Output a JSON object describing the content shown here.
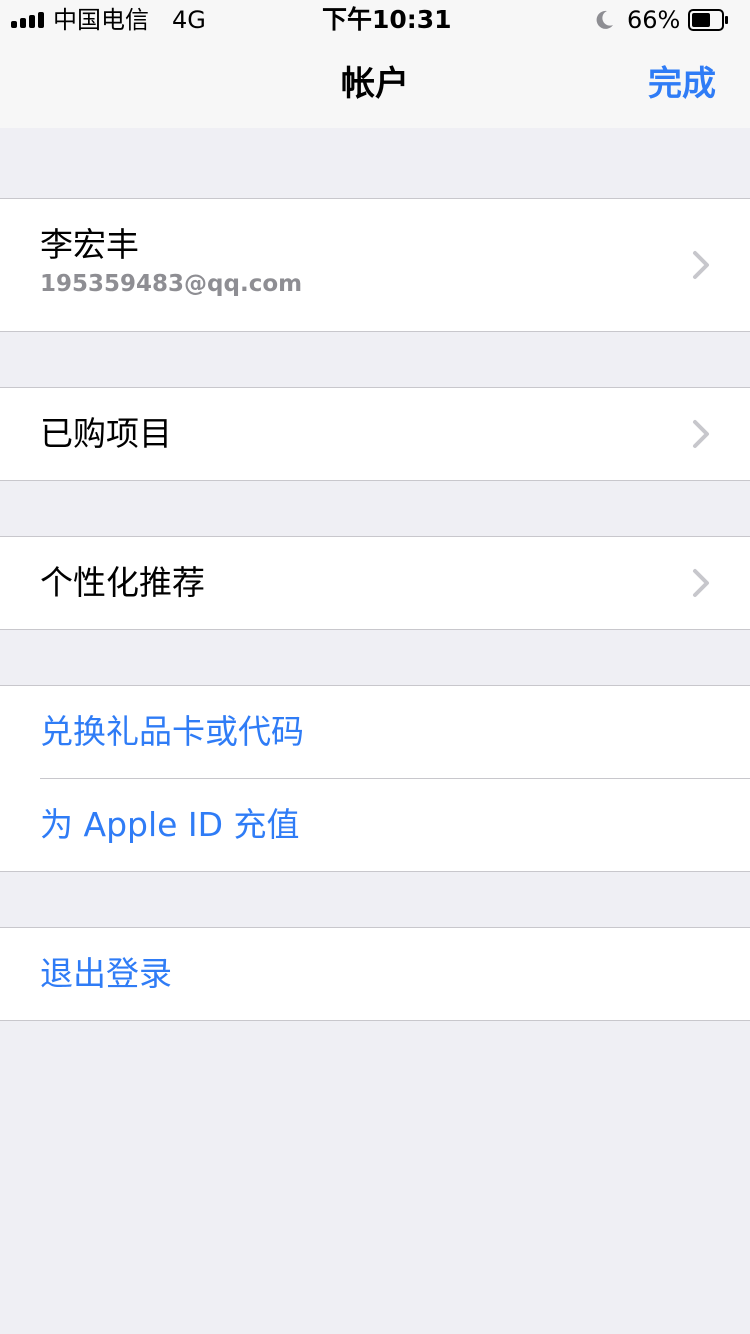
{
  "status_bar": {
    "carrier": "中国电信",
    "network": "4G",
    "time": "下午10:31",
    "battery_percent": "66%",
    "battery_level": 0.66,
    "icons": [
      "signal-icon",
      "moon-icon",
      "battery-icon"
    ]
  },
  "nav": {
    "title": "帐户",
    "done_label": "完成"
  },
  "account": {
    "name": "李宏丰",
    "email": "195359483@qq.com"
  },
  "rows": {
    "purchased": "已购项目",
    "personalized": "个性化推荐",
    "redeem": "兑换礼品卡或代码",
    "add_funds": "为 Apple ID 充值",
    "sign_out": "退出登录"
  },
  "colors": {
    "accent": "#2F7CF6",
    "background": "#EFEFF4",
    "secondary_text": "#8E8E93",
    "chevron": "#C7C7CC"
  }
}
